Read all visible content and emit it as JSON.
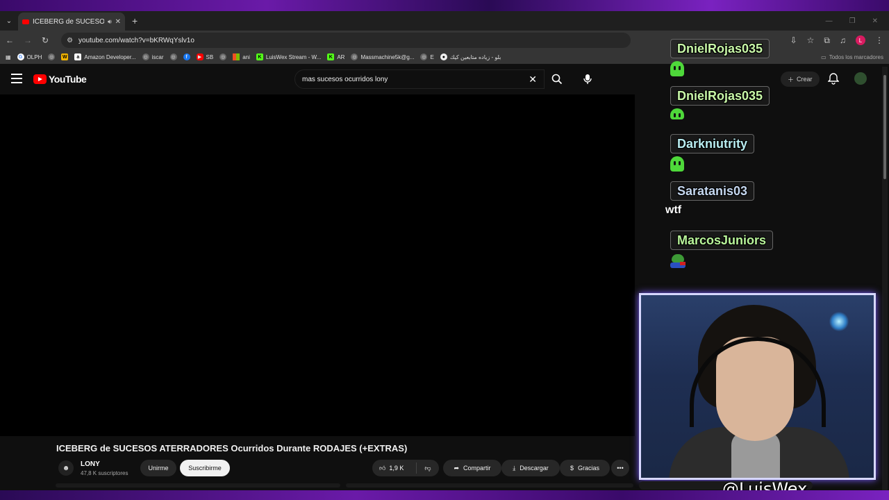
{
  "browser": {
    "tab_title": "ICEBERG de SUCESOS ATERR",
    "url": "youtube.com/watch?v=bKRWqYslv1o",
    "profile_initial": "L",
    "bookmarks": [
      {
        "label": "OLPH",
        "icon": "google-icon"
      },
      {
        "label": "",
        "icon": "globe-icon"
      },
      {
        "label": "",
        "icon": "w-icon"
      },
      {
        "label": "Amazon Developer...",
        "icon": "amazon-icon"
      },
      {
        "label": "iscar",
        "icon": "globe-icon"
      },
      {
        "label": "",
        "icon": "globe-icon"
      },
      {
        "label": "",
        "icon": "facebook-icon"
      },
      {
        "label": "SB",
        "icon": "youtube-icon"
      },
      {
        "label": "",
        "icon": "globe-icon"
      },
      {
        "label": "ani",
        "icon": "microsoft-icon"
      },
      {
        "label": "LuisWex Stream - W...",
        "icon": "kick-icon"
      },
      {
        "label": "AR",
        "icon": "kick-icon"
      },
      {
        "label": "Massmachine5k@g...",
        "icon": "globe-icon"
      },
      {
        "label": "E",
        "icon": "globe-icon"
      },
      {
        "label": "بلو - زياده متابعين كيك",
        "icon": "globe-icon"
      }
    ],
    "bookmarks_folder": "Todos los marcadores"
  },
  "youtube": {
    "logo_text": "YouTube",
    "search_value": "mas sucesos ocurridos lony",
    "create_label": "Crear",
    "video_title": "ICEBERG de SUCESOS ATERRADORES Ocurridos Durante RODAJES (+EXTRAS)",
    "channel_name": "LONY",
    "subscribers": "47,8 K suscriptores",
    "join_label": "Unirme",
    "subscribe_label": "Suscribirme",
    "likes": "1,9 K",
    "share_label": "Compartir",
    "download_label": "Descargar",
    "thanks_label": "Gracias"
  },
  "chat": [
    {
      "user": "DnielRojas035",
      "content": "",
      "emote": "green-blob-emote"
    },
    {
      "user": "DnielRojas035",
      "content": "",
      "emote": "green-blob-emote"
    },
    {
      "user": "Darkniutrity",
      "content": "",
      "emote": "green-blob-emote"
    },
    {
      "user": "Saratanis03",
      "content": "wtf",
      "emote": ""
    },
    {
      "user": "MarcosJuniors",
      "content": "",
      "emote": "frog-emote"
    }
  ],
  "stream": {
    "handle": "@LuisWex"
  },
  "colors": {
    "youtube_red": "#ff0000",
    "frame_purple": "#6a1aa8",
    "chat_name_green": "#c8f7a8"
  }
}
